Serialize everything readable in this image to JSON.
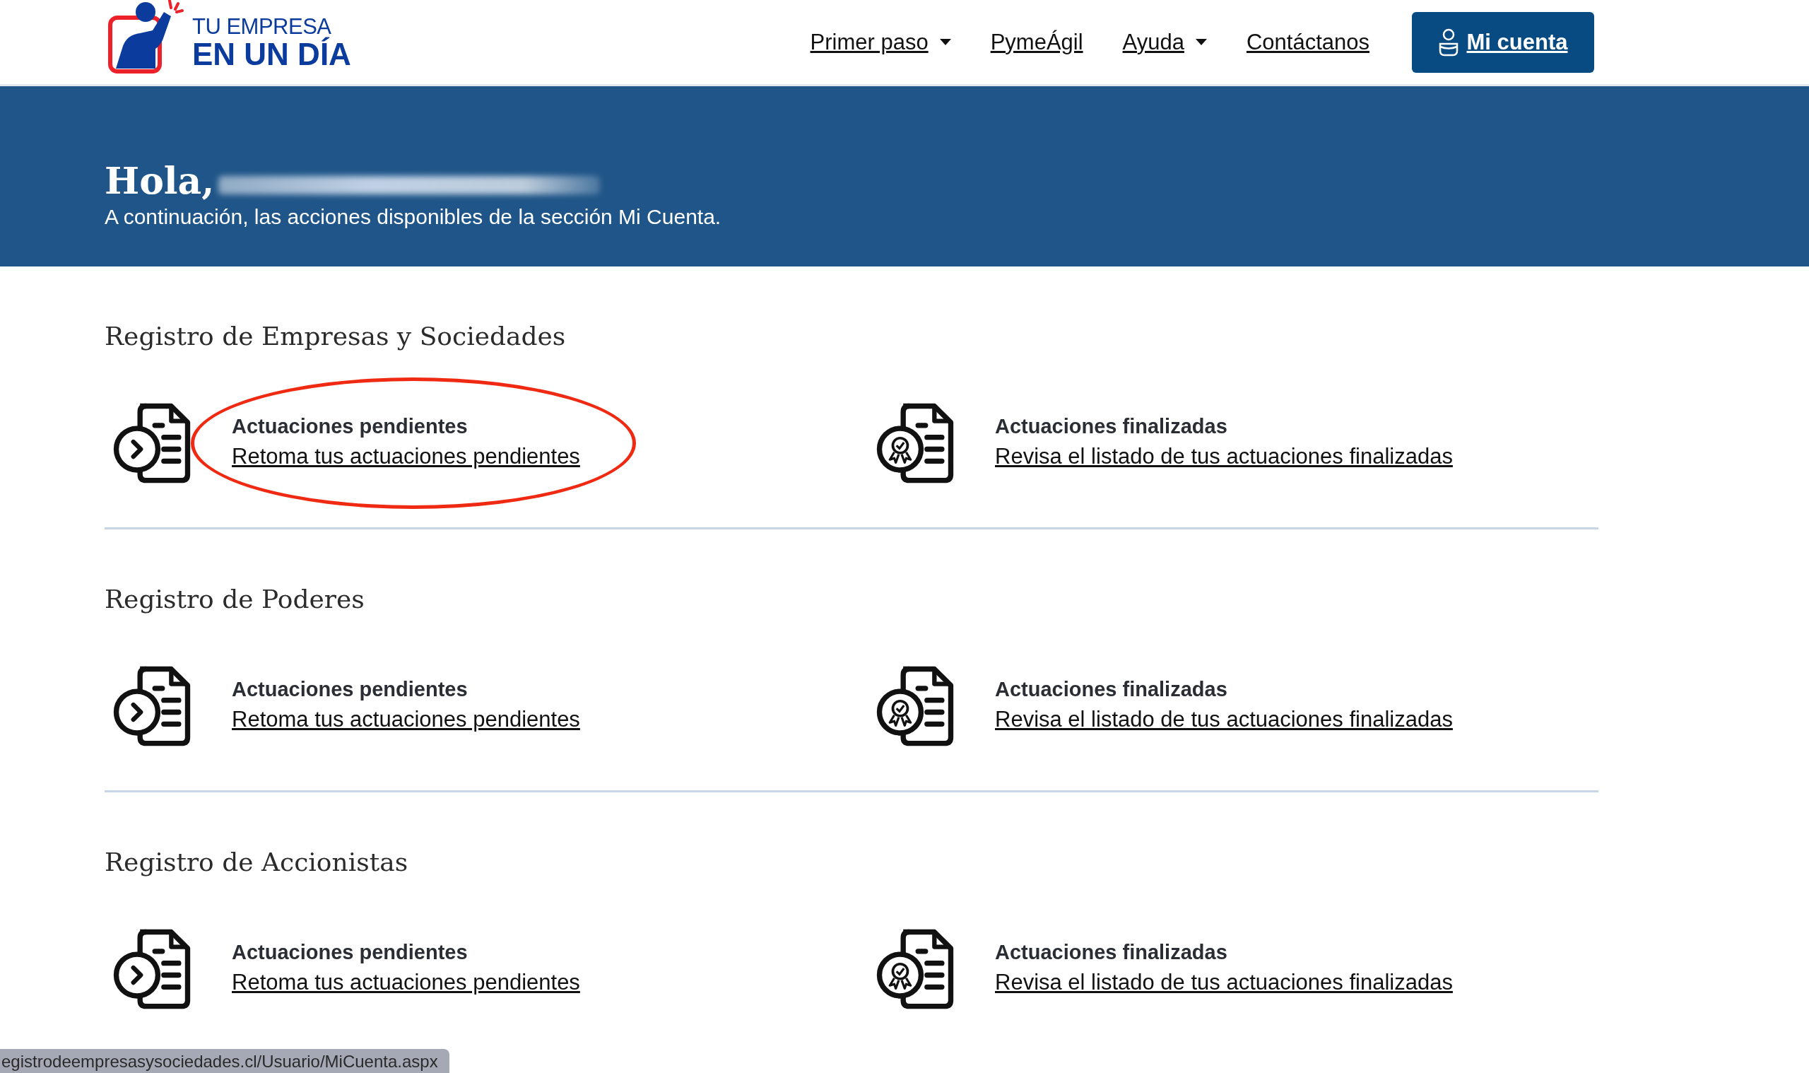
{
  "header": {
    "logo": {
      "line_1": "TU EMPRESA",
      "line_2": "EN UN DÍA"
    },
    "nav": [
      {
        "label": "Primer paso",
        "dropdown": true
      },
      {
        "label": "PymeÁgil",
        "dropdown": false
      },
      {
        "label": "Ayuda",
        "dropdown": true
      },
      {
        "label": "Contáctanos",
        "dropdown": false
      }
    ],
    "account_button": "Mi cuenta"
  },
  "hero": {
    "greeting": "Hola,",
    "name_redacted": true,
    "subtitle": "A continuación, las acciones disponibles de la sección Mi Cuenta."
  },
  "sections": [
    {
      "title": "Registro de Empresas y Sociedades",
      "items": [
        {
          "kind": "pending",
          "title": "Actuaciones pendientes",
          "link": "Retoma tus actuaciones pendientes",
          "circled": true
        },
        {
          "kind": "finished",
          "title": "Actuaciones finalizadas",
          "link": "Revisa el listado de tus actuaciones finalizadas",
          "circled": false
        }
      ]
    },
    {
      "title": "Registro de Poderes",
      "items": [
        {
          "kind": "pending",
          "title": "Actuaciones pendientes",
          "link": "Retoma tus actuaciones pendientes",
          "circled": false
        },
        {
          "kind": "finished",
          "title": "Actuaciones finalizadas",
          "link": "Revisa el listado de tus actuaciones finalizadas",
          "circled": false
        }
      ]
    },
    {
      "title": "Registro de Accionistas",
      "items": [
        {
          "kind": "pending",
          "title": "Actuaciones pendientes",
          "link": "Retoma tus actuaciones pendientes",
          "circled": false
        },
        {
          "kind": "finished",
          "title": "Actuaciones finalizadas",
          "link": "Revisa el listado de tus actuaciones finalizadas",
          "circled": false
        }
      ]
    }
  ],
  "status_bar": {
    "url": "egistrodeempresasysociedades.cl/Usuario/MiCuenta.aspx"
  }
}
